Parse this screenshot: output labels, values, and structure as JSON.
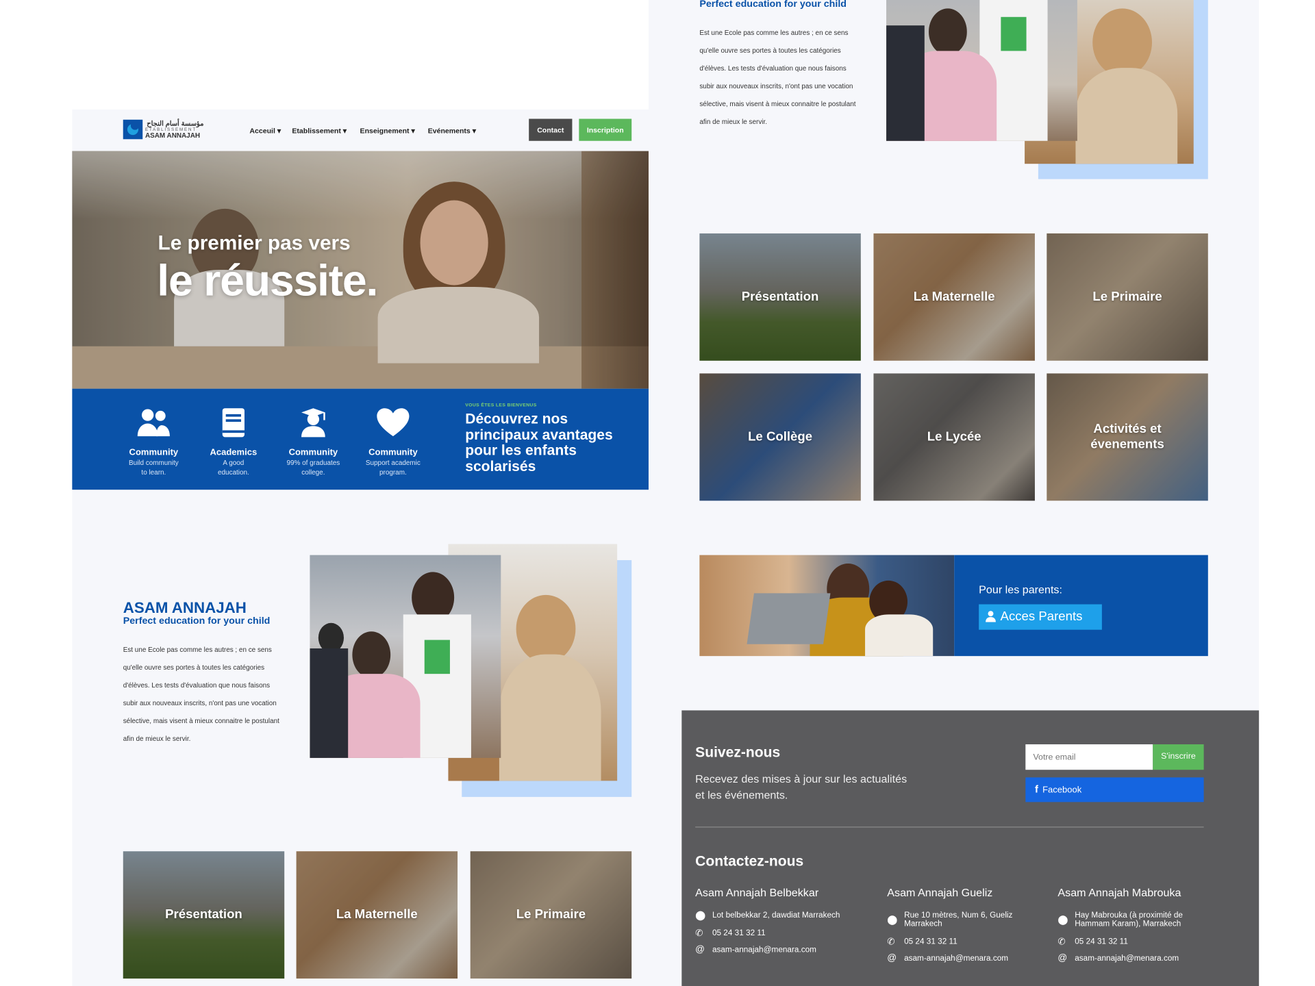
{
  "header": {
    "logo_arabic": "مؤسسة أسام النجاح",
    "logo_sub": "ETABLISSEMENT",
    "logo_name": "ASAM ANNAJAH",
    "nav": [
      "Acceuil",
      "Etablissement",
      "Enseignement",
      "Evénements"
    ],
    "contact_label": "Contact",
    "inscription_label": "Inscription"
  },
  "hero": {
    "line1": "Le premier pas vers",
    "line2": "le réussite."
  },
  "features": [
    {
      "icon": "users-icon",
      "title": "Community",
      "line1": "Build community",
      "line2": "to learn."
    },
    {
      "icon": "book-icon",
      "title": "Academics",
      "line1": "A good",
      "line2": "education."
    },
    {
      "icon": "graduate-icon",
      "title": "Community",
      "line1": "99% of graduates",
      "line2": "college."
    },
    {
      "icon": "heart-icon",
      "title": "Community",
      "line1": "Support academic",
      "line2": "program."
    }
  ],
  "welcome": {
    "kicker": "VOUS ÊTES LES BIENVENUS",
    "line1": "Découvrez nos",
    "line2": "principaux avantages",
    "line3": "pour les enfants",
    "line4": "scolarisés"
  },
  "about": {
    "title": "ASAM ANNAJAH",
    "subtitle": "Perfect education for your child",
    "lines": [
      "Est une Ecole pas comme les autres ; en ce sens",
      "qu'elle ouvre ses portes à toutes les catégories",
      "d'élèves. Les tests d'évaluation que nous faisons",
      "subir aux nouveaux inscrits, n'ont pas une vocation",
      "sélective, mais visent à mieux connaitre le postulant",
      "afin de mieux le servir."
    ]
  },
  "tiles": [
    {
      "label": "Présentation",
      "label2": ""
    },
    {
      "label": "La Maternelle",
      "label2": ""
    },
    {
      "label": "Le Primaire",
      "label2": ""
    },
    {
      "label": "Le Collège",
      "label2": ""
    },
    {
      "label": "Le Lycée",
      "label2": ""
    },
    {
      "label": "Activités et",
      "label2": "évenements"
    }
  ],
  "parents": {
    "heading": "Pour les parents:",
    "button_label": "Acces Parents"
  },
  "follow": {
    "title": "Suivez-nous",
    "line1": "Recevez des mises à jour sur les actualités",
    "line2": "et les événements.",
    "email_placeholder": "Votre email",
    "subscribe_label": "S'inscrire",
    "facebook_label": "Facebook"
  },
  "contact": {
    "title": "Contactez-nous",
    "branches": [
      {
        "name": "Asam Annajah Belbekkar",
        "addr1": "Lot belbekkar 2, dawdiat Marrakech",
        "addr2": "",
        "phone": "05 24 31 32 11",
        "email": "asam-annajah@menara.com"
      },
      {
        "name": "Asam Annajah Gueliz",
        "addr1": "Rue 10 mètres, Num 6, Gueliz",
        "addr2": "Marrakech",
        "phone": "05 24 31 32 11",
        "email": "asam-annajah@menara.com"
      },
      {
        "name": "Asam Annajah Mabrouka",
        "addr1": "Hay Mabrouka (à proximité de",
        "addr2": "Hammam Karam), Marrakech",
        "phone": "05 24 31 32 11",
        "email": "asam-annajah@menara.com"
      }
    ]
  },
  "colors": {
    "primary_blue": "#0a52a8",
    "accent_green": "#5cb85c",
    "dark_button": "#4a4a4a",
    "footer_bg": "#5b5b5d",
    "light_blue": "#bcd8fb",
    "facebook": "#1565e0"
  }
}
